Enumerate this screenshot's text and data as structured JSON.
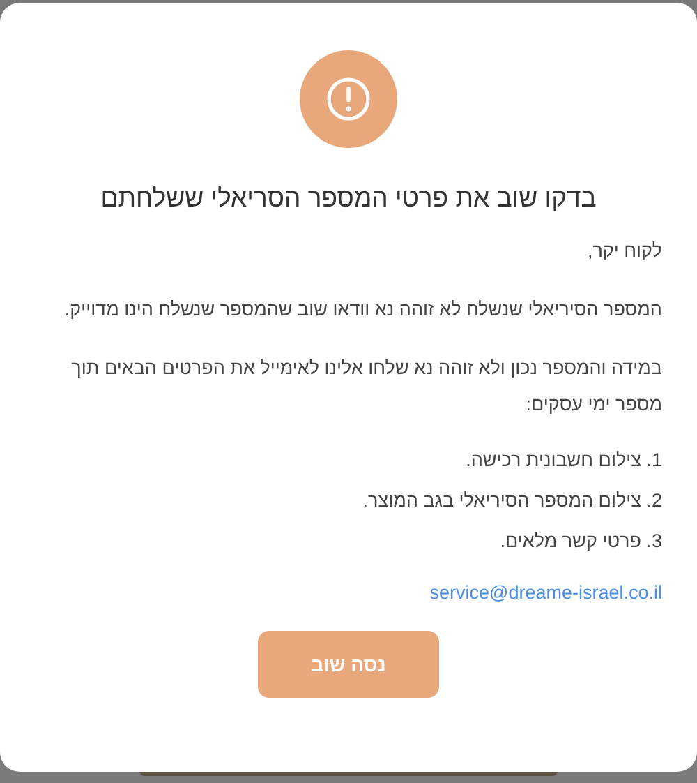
{
  "dialog": {
    "title": "בדקו שוב את פרטי המספר הסריאלי ששלחתם",
    "paragraphs": [
      "לקוח יקר,",
      "המספר הסיריאלי שנשלח לא זוהה נא וודאו שוב שהמספר שנשלח הינו מדוייק.",
      "במידה והמספר נכון ולא זוהה נא שלחו אלינו לאימייל את הפרטים הבאים תוך מספר ימי עסקים:"
    ],
    "list": [
      "1. צילום חשבונית רכישה.",
      "2. צילום המספר הסיריאלי בגב המוצר.",
      "3. פרטי קשר מלאים."
    ],
    "email": "service@dreame-israel.co.il",
    "button": "נסה שוב"
  }
}
